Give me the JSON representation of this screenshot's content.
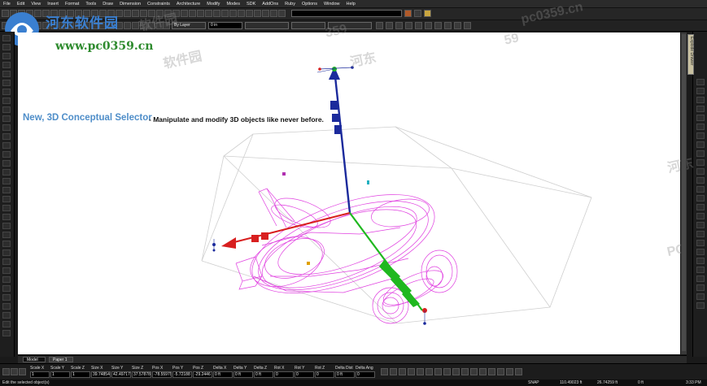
{
  "menu": [
    "File",
    "Edit",
    "View",
    "Insert",
    "Format",
    "Tools",
    "Draw",
    "Dimension",
    "Constraints",
    "Architecture",
    "Modify",
    "Modes",
    "SDK",
    "AddOns",
    "Ruby",
    "Options",
    "Window",
    "Help"
  ],
  "toolbar": {
    "layer_combo": "By Layer",
    "thickness_combo": "0 in"
  },
  "right_tab_label": "Explode Drawer",
  "headline": "New, 3D Conceptual Selector",
  "subline": "- Manipulate and modify 3D objects like never before.",
  "watermark": {
    "url": "www.pc0359.cn",
    "name": "河东软件园",
    "faint": [
      "软件园",
      "359",
      "pc0359.cn",
      "软件园",
      "河东",
      "59",
      "河东",
      "PC"
    ]
  },
  "tabs": {
    "model": "Model",
    "paper": "Paper 1"
  },
  "property_bar": [
    {
      "h": "Scale X",
      "v": "1"
    },
    {
      "h": "Scale Y",
      "v": "1"
    },
    {
      "h": "Scale Z",
      "v": "1"
    },
    {
      "h": "Size X",
      "v": "39.74854"
    },
    {
      "h": "Size Y",
      "v": "42.49717"
    },
    {
      "h": "Size Z",
      "v": "37.57878"
    },
    {
      "h": "Pos X",
      "v": "-78.55979"
    },
    {
      "h": "Pos Y",
      "v": "-5.72188"
    },
    {
      "h": "Pos Z",
      "v": "-29.2446"
    },
    {
      "h": "Delta X",
      "v": "0 ft"
    },
    {
      "h": "Delta Y",
      "v": "0 ft"
    },
    {
      "h": "Delta Z",
      "v": "0 ft"
    },
    {
      "h": "Rot X",
      "v": "0"
    },
    {
      "h": "Rot Y",
      "v": "0"
    },
    {
      "h": "Rot Z",
      "v": "0"
    },
    {
      "h": "Delta Dist",
      "v": "0 ft"
    },
    {
      "h": "Delta Ang",
      "v": "0"
    }
  ],
  "status": {
    "message": "Edit the selected object(s)",
    "snap": "SNAP",
    "coord_x": "110.49023 ft",
    "coord_y": "26.74259 ft",
    "coord_z": "0 ft",
    "time": "3:33 PM"
  },
  "colors": {
    "headline": "#4f8ec9",
    "wireframe": "#e040e0",
    "axis_y": "#1b2a9c",
    "axis_x": "#d81f1f",
    "axis_z": "#1fb81f",
    "watermark_green": "#2e8b2e",
    "watermark_blue": "#3a7fd0"
  }
}
